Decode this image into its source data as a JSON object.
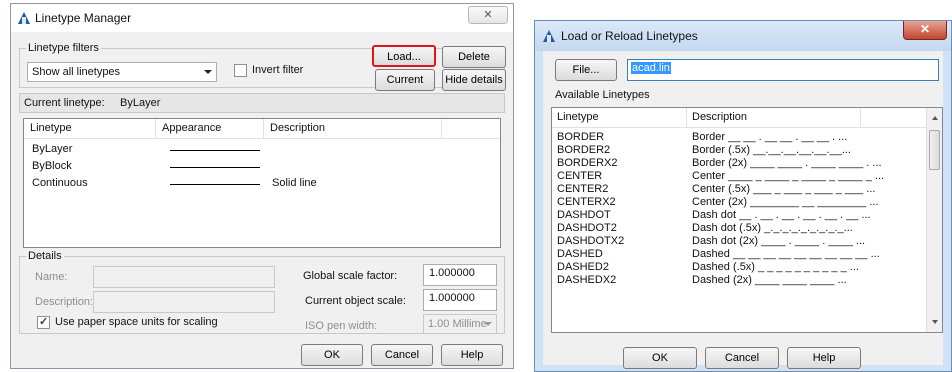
{
  "linetype_manager": {
    "title": "Linetype Manager",
    "close_label": "✕",
    "filters_label": "Linetype filters",
    "filter_value": "Show all linetypes",
    "invert_label": "Invert filter",
    "load_label": "Load...",
    "delete_label": "Delete",
    "current_label": "Current",
    "hide_details_label": "Hide details",
    "current_linetype_label": "Current linetype:",
    "current_linetype_value": "ByLayer",
    "columns": {
      "linetype": "Linetype",
      "appearance": "Appearance",
      "description": "Description"
    },
    "rows": [
      {
        "name": "ByLayer",
        "description": ""
      },
      {
        "name": "ByBlock",
        "description": ""
      },
      {
        "name": "Continuous",
        "description": "Solid line"
      }
    ],
    "details_label": "Details",
    "name_label": "Name:",
    "description_label": "Description:",
    "paper_space_label": "Use paper space units for scaling",
    "global_scale_label": "Global scale factor:",
    "global_scale_value": "1.000000",
    "object_scale_label": "Current object scale:",
    "object_scale_value": "1.000000",
    "iso_pen_label": "ISO pen width:",
    "iso_pen_value": "1.00 Millime",
    "ok_label": "OK",
    "cancel_label": "Cancel",
    "help_label": "Help",
    "highlight_color": "#e0141e"
  },
  "load_reload": {
    "title": "Load or Reload Linetypes",
    "close_label": "✕",
    "file_label": "File...",
    "file_value": "acad.lin",
    "available_label": "Available Linetypes",
    "columns": {
      "linetype": "Linetype",
      "description": "Description"
    },
    "rows": [
      {
        "name": "BORDER",
        "description": "Border __ __ . __ __ . __ __ . ..."
      },
      {
        "name": "BORDER2",
        "description": "Border (.5x) __.__.__.__.__.__..."
      },
      {
        "name": "BORDERX2",
        "description": "Border (2x) ____ ____ . ____ ____ . ..."
      },
      {
        "name": "CENTER",
        "description": "Center ____ _ ____ _ ____ _ ____ _ ..."
      },
      {
        "name": "CENTER2",
        "description": "Center (.5x) ___ _ ___ _ ___ _ ___ ..."
      },
      {
        "name": "CENTERX2",
        "description": "Center (2x) ________ __ ________ ..."
      },
      {
        "name": "DASHDOT",
        "description": "Dash dot __ . __ . __ . __ . __ . __ ..."
      },
      {
        "name": "DASHDOT2",
        "description": "Dash dot (.5x) _._._._._._._._._..."
      },
      {
        "name": "DASHDOTX2",
        "description": "Dash dot (2x) ____ . ____ . ____ ..."
      },
      {
        "name": "DASHED",
        "description": "Dashed __ __ __ __ __ __ __ __ __ ..."
      },
      {
        "name": "DASHED2",
        "description": "Dashed (.5x) _ _ _ _ _ _ _ _ _ _ ..."
      },
      {
        "name": "DASHEDX2",
        "description": "Dashed (2x) ____ ____ ____ ..."
      }
    ],
    "ok_label": "OK",
    "cancel_label": "Cancel",
    "help_label": "Help"
  }
}
